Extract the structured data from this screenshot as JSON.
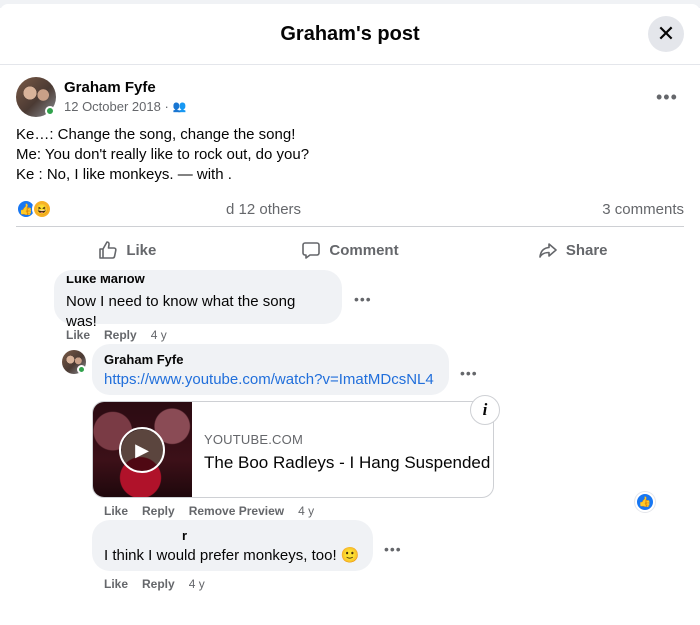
{
  "modal": {
    "title": "Graham's post",
    "close_icon": "close-icon"
  },
  "post": {
    "author": "Graham Fyfe",
    "date": "12 October 2018 ·",
    "audience_icon": "friends-icon",
    "lines": [
      "Ke…: Change the song, change the song!",
      "Me: You don't really like to rock out, do you?",
      "Ke   : No, I like monkeys. — with                 ."
    ],
    "reaction_summary": "d 12 others",
    "comments_count": "3 comments"
  },
  "actions": {
    "like": "Like",
    "comment": "Comment",
    "share": "Share"
  },
  "comments": [
    {
      "name": "Luke Marlow",
      "text": "Now I need to know what the song was!",
      "like": "Like",
      "reply": "Reply",
      "time": "4 y"
    },
    {
      "name": "Graham Fyfe",
      "link": "https://www.youtube.com/watch?v=ImatMDcsNL4",
      "like": "Like",
      "reply": "Reply",
      "remove_preview": "Remove Preview",
      "time": "4 y",
      "preview": {
        "domain": "YOUTUBE.COM",
        "title": "The Boo Radleys - I Hang Suspended"
      }
    },
    {
      "name": "r",
      "text": "I think I would prefer monkeys, too! 🙂",
      "like": "Like",
      "reply": "Reply",
      "time": "4 y"
    }
  ],
  "colors": {
    "facebook_blue": "#1877f2",
    "link_blue": "#216fdb",
    "secondary_text": "#65676b",
    "bubble_bg": "#f0f2f5"
  }
}
